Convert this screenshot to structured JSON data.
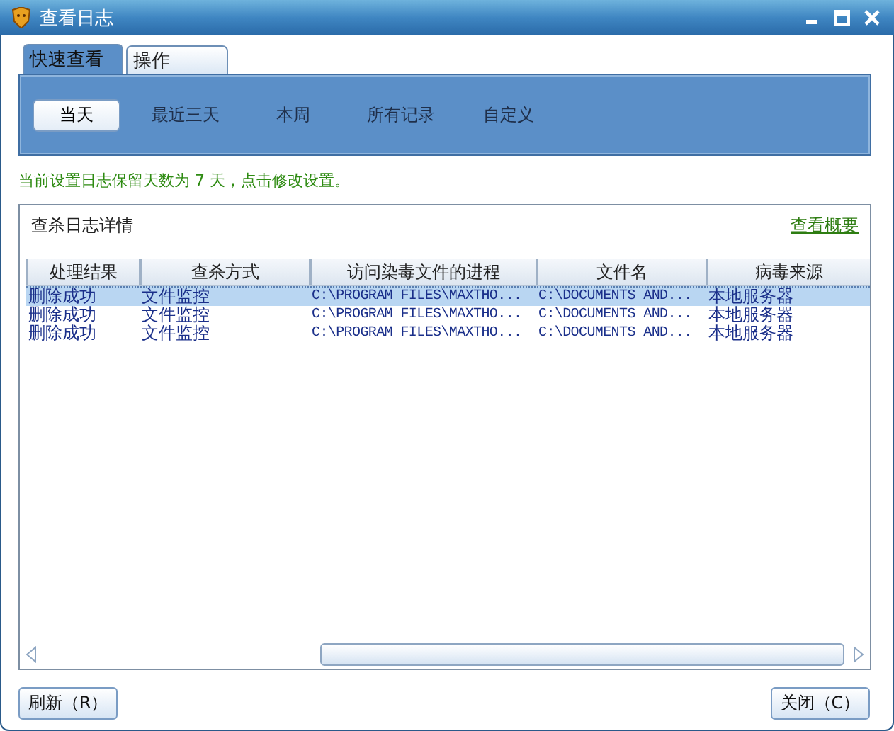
{
  "window": {
    "title": "查看日志"
  },
  "tabs": [
    {
      "label": "快速查看",
      "selected": true
    },
    {
      "label": "操作",
      "selected": false
    }
  ],
  "filters": [
    {
      "label": "当天",
      "selected": true
    },
    {
      "label": "最近三天",
      "selected": false
    },
    {
      "label": "本周",
      "selected": false
    },
    {
      "label": "所有记录",
      "selected": false
    },
    {
      "label": "自定义",
      "selected": false
    }
  ],
  "retention_notice": "当前设置日志保留天数为 7 天，点击修改设置。",
  "details": {
    "title": "查杀日志详情",
    "summary_link": "查看概要"
  },
  "table": {
    "columns": [
      "处理结果",
      "查杀方式",
      "访问染毒文件的进程",
      "文件名",
      "病毒来源"
    ],
    "rows": [
      {
        "cells": [
          "删除成功",
          "文件监控",
          "C:\\PROGRAM FILES\\MAXTHO...",
          "C:\\DOCUMENTS AND...",
          "本地服务器"
        ],
        "selected": true
      },
      {
        "cells": [
          "删除成功",
          "文件监控",
          "C:\\PROGRAM FILES\\MAXTHO...",
          "C:\\DOCUMENTS AND...",
          "本地服务器"
        ],
        "selected": false
      },
      {
        "cells": [
          "删除成功",
          "文件监控",
          "C:\\PROGRAM FILES\\MAXTHO...",
          "C:\\DOCUMENTS AND...",
          "本地服务器"
        ],
        "selected": false
      }
    ]
  },
  "buttons": [
    {
      "label": "刷新（R）"
    },
    {
      "label": "关闭（C）"
    }
  ]
}
